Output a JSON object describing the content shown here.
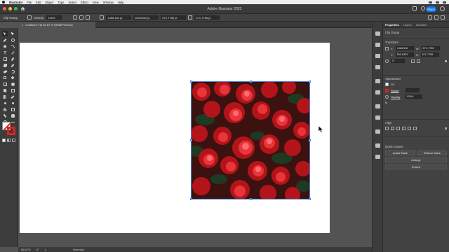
{
  "menubar": {
    "app_name": "Illustrator",
    "items": [
      "File",
      "Edit",
      "Object",
      "Type",
      "Select",
      "Effect",
      "View",
      "Window",
      "Help"
    ]
  },
  "titlebar": {
    "title": "Adobe Illustrator 2023",
    "share_label": "Share"
  },
  "controlbar": {
    "selection_label": "Clip Group",
    "opacity_label": "Opacity:",
    "opacity_value": "100%",
    "x_value": "1468.432 pt",
    "y_value": "553.6302 pt",
    "w_value": "671.7785 pt",
    "h_value": "671.7785 pt"
  },
  "document_tab": {
    "title": "Untitled-2* @ 66.67 % (RGB/Preview)",
    "close_glyph": "×"
  },
  "statusbar": {
    "zoom": "66.67%",
    "rotation": "0°",
    "artboard_number": "1",
    "tool": "Selection"
  },
  "properties": {
    "tabs": [
      "Properties",
      "Layers",
      "Libraries"
    ],
    "selection_type": "Clip Group",
    "transform_title": "Transform",
    "x_label": "X:",
    "x_value": "1468.432",
    "y_label": "Y:",
    "y_value": "553.6302",
    "w_label": "W:",
    "w_value": "671.7785",
    "h_label": "H:",
    "h_value": "671.7785",
    "angle_value": "0°",
    "appearance_title": "Appearance",
    "fill_label": "Fill",
    "stroke_label": "Stroke",
    "opacity_label": "Opacity",
    "opacity_value": "100%",
    "fx_label": "fx.",
    "align_title": "Align",
    "quick_actions_title": "Quick Actions",
    "isolate_mask_label": "Isolate Mask",
    "release_mask_label": "Release Mask",
    "arrange_label": "Arrange",
    "embed_label": "Embed"
  },
  "colors": {
    "accent": "#1473e6",
    "selection": "#4a7fe0",
    "stroke_red": "#e02020",
    "panel": "#424242",
    "workspace": "#535353"
  }
}
